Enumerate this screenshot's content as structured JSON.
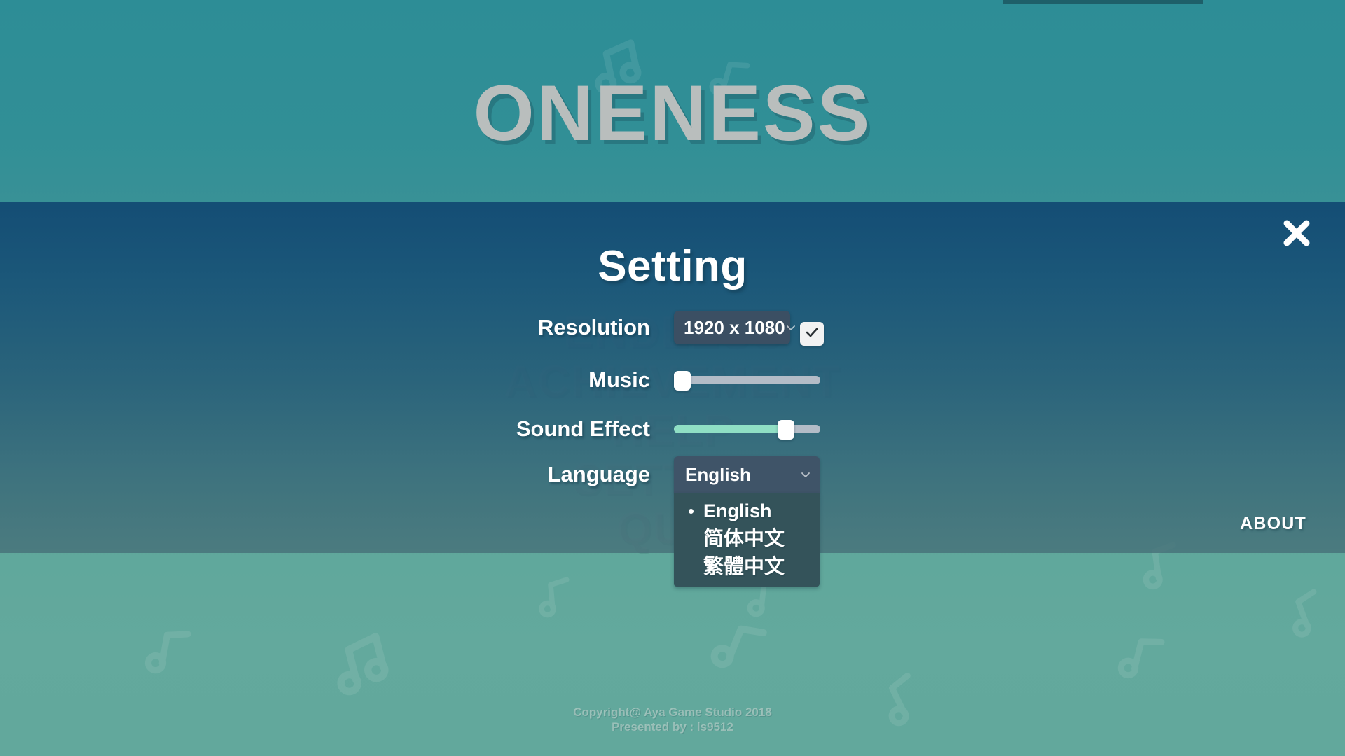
{
  "game": {
    "title": "ONENESS",
    "background_menu": [
      "ENDLESS",
      "ACHIEVEMENT",
      "HELP",
      "SETTING",
      "QUIT"
    ],
    "about_label": "ABOUT",
    "footer_line1": "Copyright@ Aya Game Studio 2018",
    "footer_line2": "Presented by : ls9512"
  },
  "settings": {
    "panel_title": "Setting",
    "close_icon": "close-icon",
    "rows": {
      "resolution": {
        "label": "Resolution",
        "value": "1920 x 1080",
        "chevron_icon": "chevron-down-icon",
        "fullscreen_checked": true,
        "check_icon": "check-icon"
      },
      "music": {
        "label": "Music",
        "value": 0,
        "min": 0,
        "max": 100
      },
      "sound_effect": {
        "label": "Sound Effect",
        "value": 80,
        "min": 0,
        "max": 100
      },
      "language": {
        "label": "Language",
        "value": "English",
        "chevron_icon": "chevron-down-icon",
        "expanded": true,
        "options": [
          {
            "label": "English",
            "selected": true
          },
          {
            "label": "简体中文",
            "selected": false
          },
          {
            "label": "繁體中文",
            "selected": false
          }
        ]
      }
    }
  },
  "colors": {
    "bg_top": "#2d8d96",
    "bg_bottom": "#62a89c",
    "panel": "#164f75",
    "select_bg": "#3b4f63",
    "dropdown_bg": "#34535a",
    "slider_fill": "#8fdfc4",
    "slider_track": "#b3bcc7",
    "title_text": "#b9bebd",
    "white": "#ffffff"
  }
}
